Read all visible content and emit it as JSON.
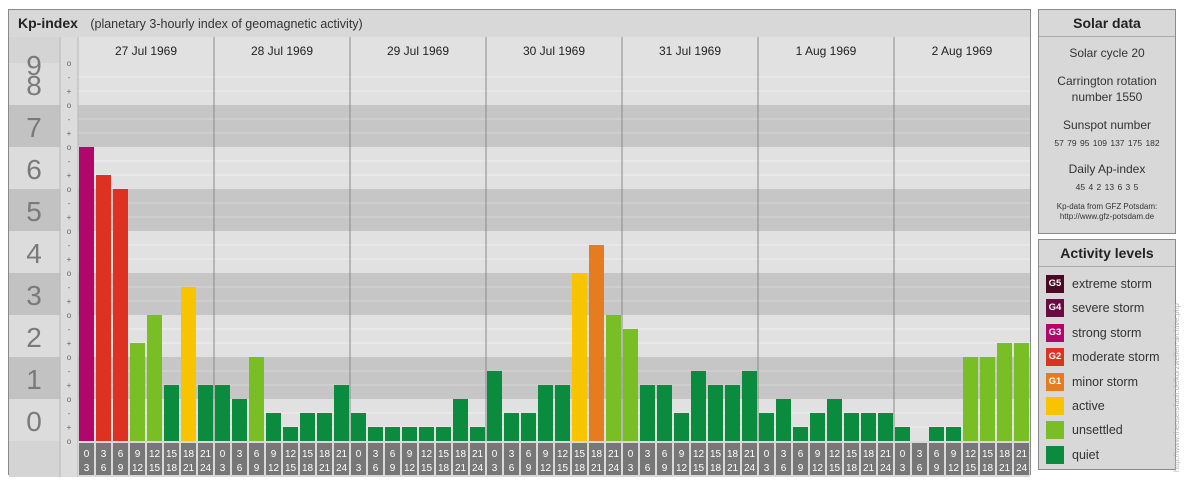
{
  "header": {
    "title": "Kp-index",
    "subtitle": "(planetary 3-hourly index of geomagnetic activity)"
  },
  "solar": {
    "title": "Solar data",
    "cycle": "Solar cycle 20",
    "carrington_line1": "Carrington rotation",
    "carrington_line2": "number 1550",
    "sunspot_label": "Sunspot number",
    "sunspot_values": "57  79  95  109  137  175  182",
    "ap_label": "Daily Ap-index",
    "ap_values": "45   4   2   13   6   3   5",
    "source_line1": "Kp-data from GFZ Potsdam:",
    "source_line2": "http://www.gfz-potsdam.de"
  },
  "activity": {
    "title": "Activity levels",
    "levels": [
      {
        "code": "G5",
        "label": "extreme storm",
        "color": "#4a0a24"
      },
      {
        "code": "G4",
        "label": "severe storm",
        "color": "#6a0b43"
      },
      {
        "code": "G3",
        "label": "strong storm",
        "color": "#b0086a"
      },
      {
        "code": "G2",
        "label": "moderate storm",
        "color": "#dd3222"
      },
      {
        "code": "G1",
        "label": "minor storm",
        "color": "#e57c1f"
      },
      {
        "code": "",
        "label": "active",
        "color": "#f8c400"
      },
      {
        "code": "",
        "label": "unsettled",
        "color": "#79be25"
      },
      {
        "code": "",
        "label": "quiet",
        "color": "#0a8b3e"
      }
    ]
  },
  "watermark": "http://www.theusersfault.de/kurzwellen-archive.php",
  "chart_data": {
    "type": "bar",
    "title": "Kp-index",
    "ylim": [
      0,
      9
    ],
    "y_ticks": [
      "0",
      "1",
      "2",
      "3",
      "4",
      "5",
      "6",
      "7",
      "8",
      "9"
    ],
    "minor_marks": [
      "o",
      "+",
      "-"
    ],
    "days": [
      "27 Jul 1969",
      "28 Jul 1969",
      "29 Jul 1969",
      "30 Jul 1969",
      "31 Jul 1969",
      "1 Aug 1969",
      "2 Aug 1969"
    ],
    "hour_start_labels": [
      "0",
      "3",
      "6",
      "9",
      "12",
      "15",
      "18",
      "21"
    ],
    "hour_end_labels": [
      "3",
      "6",
      "9",
      "12",
      "15",
      "18",
      "21",
      "24"
    ],
    "values": [
      [
        7.0,
        6.333,
        6.0,
        2.333,
        3.0,
        1.333,
        3.667,
        1.333
      ],
      [
        1.333,
        1.0,
        2.0,
        0.667,
        0.333,
        0.667,
        0.667,
        1.333
      ],
      [
        0.667,
        0.333,
        0.333,
        0.333,
        0.333,
        0.333,
        1.0,
        0.333
      ],
      [
        1.667,
        0.667,
        0.667,
        1.333,
        1.333,
        4.0,
        4.667,
        3.0
      ],
      [
        2.667,
        1.333,
        1.333,
        0.667,
        1.667,
        1.333,
        1.333,
        1.667
      ],
      [
        0.667,
        1.0,
        0.333,
        0.667,
        1.0,
        0.667,
        0.667,
        0.667
      ],
      [
        0.333,
        0.0,
        0.333,
        0.333,
        2.0,
        2.0,
        2.333,
        2.333
      ]
    ],
    "colors": {
      "quiet": "#0a8b3e",
      "unsettled": "#79be25",
      "active": "#f8c400",
      "G1": "#e57c1f",
      "G2": "#dd3222",
      "G3": "#b0086a"
    }
  }
}
